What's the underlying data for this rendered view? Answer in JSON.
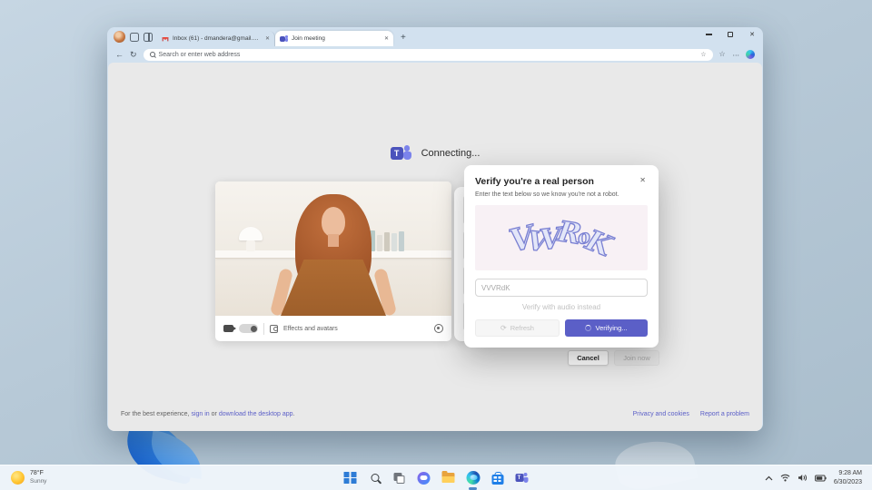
{
  "glyphs": {
    "close": "✕",
    "plus": "+",
    "back": "←",
    "refresh": "↻",
    "more": "⋯",
    "fav_star": "☆",
    "hub_star": "☆",
    "refresh_small": "⟳"
  },
  "browser": {
    "tabs": [
      {
        "label": "Inbox (61) - dmandera@gmail.com"
      },
      {
        "label": "Join meeting"
      }
    ],
    "address_placeholder": "Search or enter web address"
  },
  "teams_page": {
    "status": "Connecting...",
    "teams_logo_letter": "T",
    "video_controls": {
      "effects": "Effects and avatars"
    },
    "captcha_dialog": {
      "title": "Verify you're a real person",
      "subtitle": "Enter the text below so we know you're not a robot.",
      "captcha_letters": [
        "V",
        "V",
        "V",
        "R",
        "o",
        "K"
      ],
      "input_value": "VVVRdK",
      "audio_link": "Verify with audio instead",
      "refresh_button": "Refresh",
      "verifying_button": "Verifying..."
    },
    "cancel_button": "Cancel",
    "join_button": "Join now",
    "footer_note": {
      "prefix": "For the best experience,",
      "sign_in_link": "sign in",
      "connector": "or",
      "download_link": "download the desktop app",
      "suffix": "."
    },
    "footer_links": {
      "privacy": "Privacy and cookies",
      "report": "Report a problem"
    }
  },
  "taskbar": {
    "weather": {
      "temp": "78°F",
      "condition": "Sunny"
    },
    "clock": {
      "time": "9:28 AM",
      "date": "6/30/2023"
    }
  },
  "colors": {
    "accent_purple": "#5b5fc7",
    "teams_dark": "#4b53bc",
    "teams_light": "#7b83eb"
  }
}
